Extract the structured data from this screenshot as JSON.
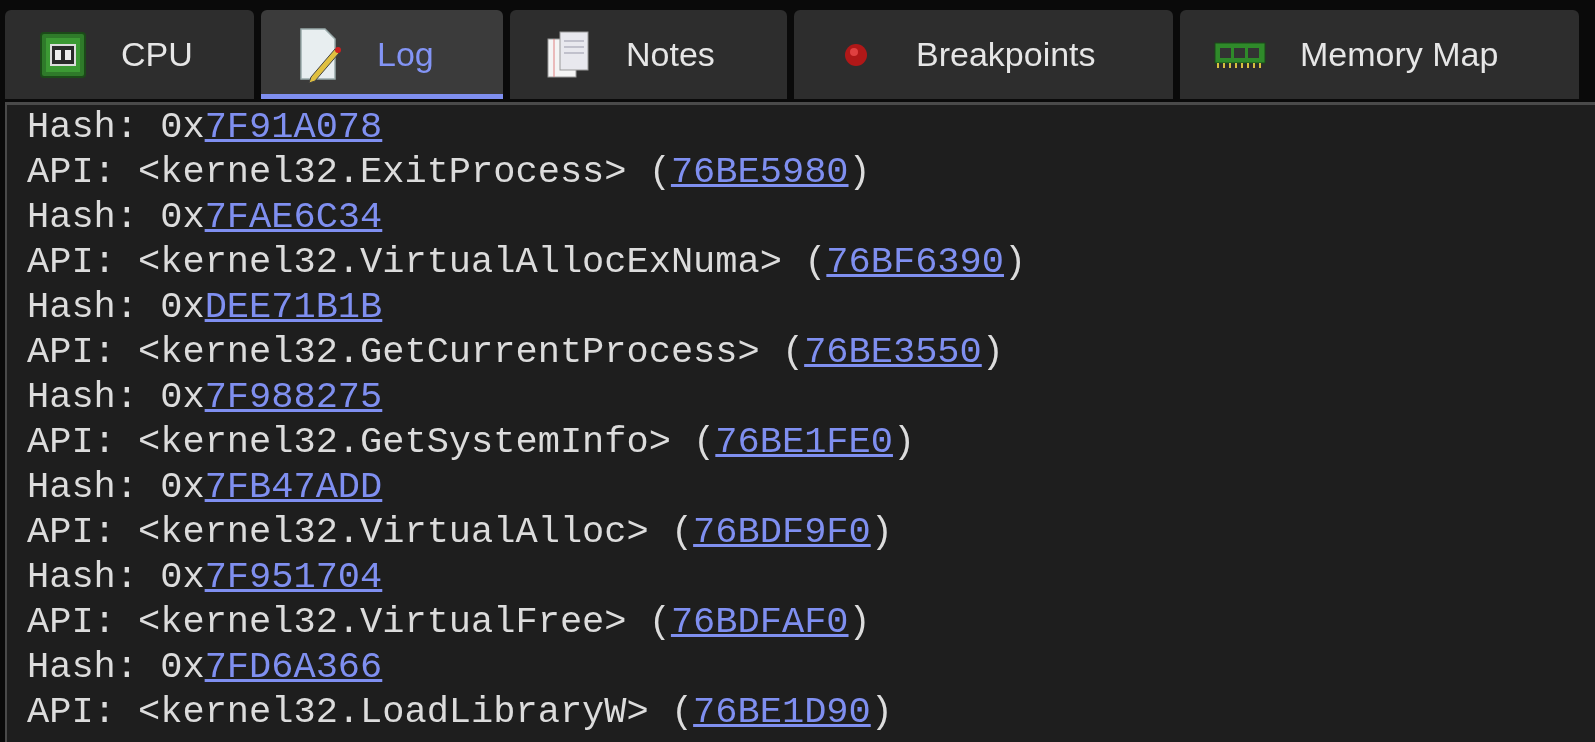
{
  "tabs": [
    {
      "label": "CPU",
      "kind": "cpu",
      "selected": false
    },
    {
      "label": "Log",
      "kind": "log",
      "selected": true
    },
    {
      "label": "Notes",
      "kind": "notes",
      "selected": false
    },
    {
      "label": "Breakpoints",
      "kind": "breakpoints",
      "selected": false
    },
    {
      "label": "Memory Map",
      "kind": "memory",
      "selected": false
    }
  ],
  "log_lines": [
    {
      "prefix": "Hash: 0x",
      "link": "7F91A078"
    },
    {
      "prefix": "API: <kernel32.ExitProcess> (",
      "link": "76BE5980",
      "suffix": ")"
    },
    {
      "prefix": "Hash: 0x",
      "link": "7FAE6C34"
    },
    {
      "prefix": "API: <kernel32.VirtualAllocExNuma> (",
      "link": "76BF6390",
      "suffix": ")"
    },
    {
      "prefix": "Hash: 0x",
      "link": "DEE71B1B"
    },
    {
      "prefix": "API: <kernel32.GetCurrentProcess> (",
      "link": "76BE3550",
      "suffix": ")"
    },
    {
      "prefix": "Hash: 0x",
      "link": "7F988275"
    },
    {
      "prefix": "API: <kernel32.GetSystemInfo> (",
      "link": "76BE1FE0",
      "suffix": ")"
    },
    {
      "prefix": "Hash: 0x",
      "link": "7FB47ADD"
    },
    {
      "prefix": "API: <kernel32.VirtualAlloc> (",
      "link": "76BDF9F0",
      "suffix": ")"
    },
    {
      "prefix": "Hash: 0x",
      "link": "7F951704"
    },
    {
      "prefix": "API: <kernel32.VirtualFree> (",
      "link": "76BDFAF0",
      "suffix": ")"
    },
    {
      "prefix": "Hash: 0x",
      "link": "7FD6A366"
    },
    {
      "prefix": "API: <kernel32.LoadLibraryW> (",
      "link": "76BE1D90",
      "suffix": ")"
    }
  ]
}
